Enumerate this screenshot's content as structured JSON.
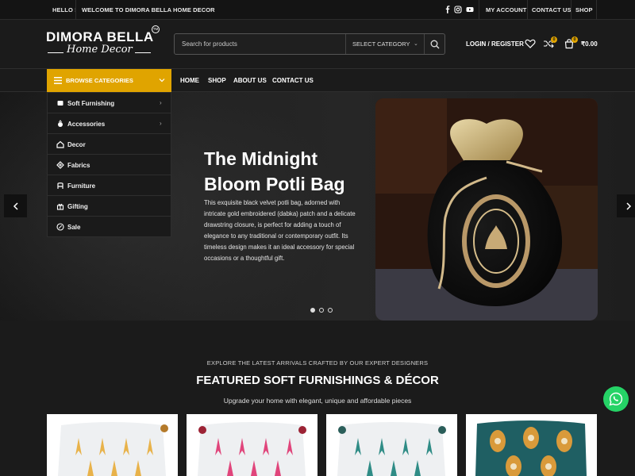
{
  "topbar": {
    "greeting": "HELLO !",
    "welcome": "WELCOME TO DIMORA BELLA HOME DECOR",
    "social_icons": [
      "facebook-icon",
      "instagram-icon",
      "youtube-icon"
    ],
    "links": [
      "MY ACCOUNT",
      "CONTACT US",
      "SHOP"
    ]
  },
  "header": {
    "logo_main": "DIMORA BELLA",
    "logo_tm": "TM",
    "logo_sub": "Home Decor",
    "search_placeholder": "Search for products",
    "search_category": "SELECT CATEGORY",
    "login_label": "LOGIN / REGISTER",
    "compare_count": "0",
    "cart_count": "0",
    "cart_total": "₹0.00"
  },
  "nav": {
    "browse_label": "BROWSE CATEGORIES",
    "links": [
      "HOME",
      "SHOP",
      "ABOUT US",
      "CONTACT US"
    ]
  },
  "categories": [
    {
      "label": "Soft Furnishing",
      "icon": "cushion-icon",
      "has_sub": true
    },
    {
      "label": "Accessories",
      "icon": "accessories-icon",
      "has_sub": true
    },
    {
      "label": "Decor",
      "icon": "home-icon",
      "has_sub": false
    },
    {
      "label": "Fabrics",
      "icon": "fabric-icon",
      "has_sub": false
    },
    {
      "label": "Furniture",
      "icon": "chair-icon",
      "has_sub": false
    },
    {
      "label": "Gifting",
      "icon": "gift-icon",
      "has_sub": false
    },
    {
      "label": "Sale",
      "icon": "sale-icon",
      "has_sub": false
    }
  ],
  "hero": {
    "title_line1": "The Midnight",
    "title_line2": "Bloom Potli Bag",
    "description": "This exquisite black velvet potli bag, adorned with intricate gold embroidered (dabka) patch and a delicate drawstring closure, is perfect for adding a touch of elegance to any traditional or contemporary outfit. Its timeless design makes it an ideal accessory for special occasions or a thoughtful gift.",
    "slide_count": 3,
    "active_slide": 1
  },
  "featured": {
    "kicker": "EXPLORE THE LATEST ARRIVALS CRAFTED BY OUR EXPERT DESIGNERS",
    "title": "FEATURED SOFT FURNISHINGS & DÉCOR",
    "subtitle": "Upgrade your home with elegant, unique and affordable pieces"
  },
  "colors": {
    "accent": "#e0a400",
    "background": "#1b1b1b",
    "whatsapp": "#25d366"
  }
}
